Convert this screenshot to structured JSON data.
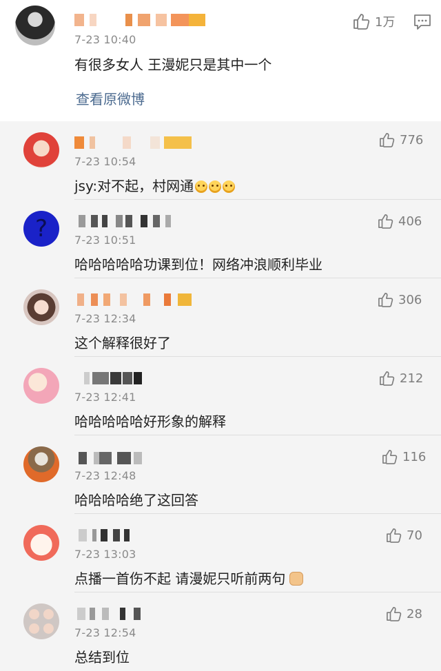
{
  "post": {
    "time": "7-23 10:40",
    "text": "有很多女人 王漫妮只是其中一个",
    "likes": "1万",
    "view_original": "查看原微博"
  },
  "comments": [
    {
      "time": "7-23 10:54",
      "text": "jsy:对不起，村网通",
      "likes": "776",
      "avatar_icon": "red-hair-girl-avatar",
      "emoji": [
        "doge-emoji",
        "doge-emoji",
        "doge-emoji"
      ]
    },
    {
      "time": "7-23 10:51",
      "text": "哈哈哈哈哈功课到位！网络冲浪顺利毕业",
      "likes": "406",
      "avatar_icon": "question-mark-avatar"
    },
    {
      "time": "7-23 12:34",
      "text": "这个解释很好了",
      "likes": "306",
      "avatar_icon": "girl-photo-avatar"
    },
    {
      "time": "7-23 12:41",
      "text": "哈哈哈哈哈好形象的解释",
      "likes": "212",
      "avatar_icon": "cartoon-boy-avatar"
    },
    {
      "time": "7-23 12:48",
      "text": "哈哈哈哈绝了这回答",
      "likes": "116",
      "avatar_icon": "toy-figure-avatar"
    },
    {
      "time": "7-23 13:03",
      "text": "点播一首伤不起 请漫妮只听前两句",
      "likes": "70",
      "avatar_icon": "cartoon-face-avatar"
    },
    {
      "time": "7-23 12:54",
      "text": "总结到位",
      "likes": "28",
      "avatar_icon": "group-photo-avatar"
    }
  ],
  "colors": {
    "link": "#4b6a8f",
    "meta": "#8a8a8a",
    "question_avatar": "#1a22c8"
  }
}
